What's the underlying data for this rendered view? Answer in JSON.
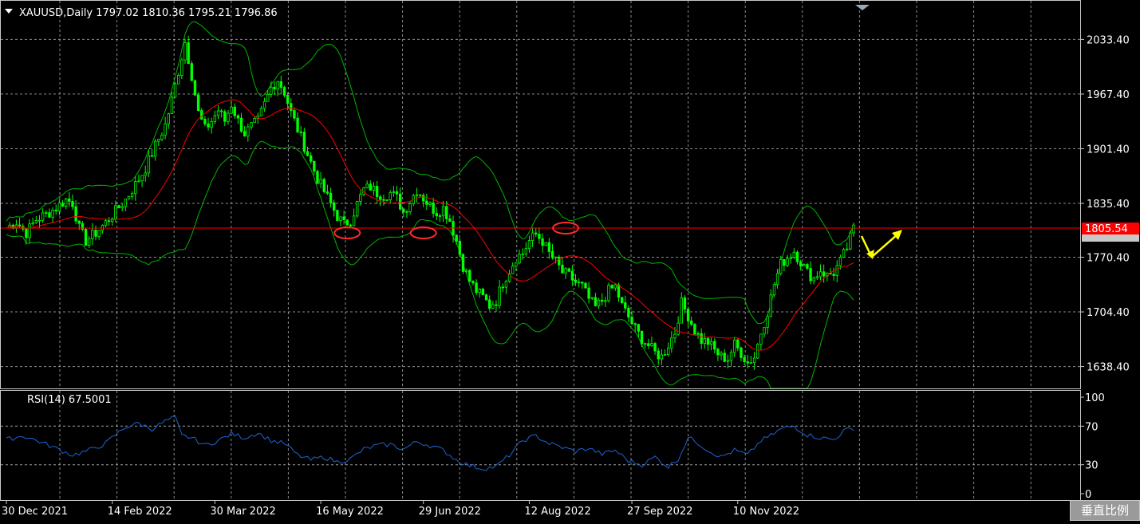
{
  "window": {
    "symbol_header": "XAUUSD,Daily  1797.02 1810.36 1795.21 1796.86",
    "scale_button": "垂直比例",
    "colors": {
      "background": "#000000",
      "grid": "#c8c8c8",
      "bull_candle": "#00ff00",
      "ma": "#ff0000",
      "bands": "#00b400",
      "rsi": "#1e64d2",
      "hline": "#ff0000",
      "markers": "#ff2b2b",
      "arrows": "#ffff00",
      "price_tag": "#ff0000"
    }
  },
  "chart_data": [
    {
      "type": "candlestick",
      "title": "XAUUSD,Daily  1797.02 1810.36 1795.21 1796.86",
      "ohlc_last": {
        "open": 1797.02,
        "high": 1810.36,
        "low": 1795.21,
        "close": 1796.86
      },
      "x": [
        "30 Dec 2021",
        "14 Feb 2022",
        "30 Mar 2022",
        "16 May 2022",
        "29 Jun 2022",
        "12 Aug 2022",
        "27 Sep 2022",
        "10 Nov 2022"
      ],
      "yticks": [
        "2033.40",
        "1967.40",
        "1901.40",
        "1835.40",
        "1770.40",
        "1704.40",
        "1638.40"
      ],
      "ylim": [
        1612,
        2080
      ],
      "price_line": {
        "value": 1805.54,
        "label": "1805.54"
      },
      "close_series": [
        [
          0,
          1806
        ],
        [
          3,
          1813
        ],
        [
          6,
          1800
        ],
        [
          9,
          1816
        ],
        [
          12,
          1822
        ],
        [
          15,
          1830
        ],
        [
          18,
          1840
        ],
        [
          20,
          1836
        ],
        [
          22,
          1805
        ],
        [
          24,
          1790
        ],
        [
          27,
          1800
        ],
        [
          30,
          1812
        ],
        [
          33,
          1826
        ],
        [
          36,
          1840
        ],
        [
          39,
          1858
        ],
        [
          42,
          1878
        ],
        [
          45,
          1905
        ],
        [
          48,
          1930
        ],
        [
          50,
          1960
        ],
        [
          52,
          1995
        ],
        [
          54,
          2030
        ],
        [
          56,
          1990
        ],
        [
          58,
          1945
        ],
        [
          60,
          1925
        ],
        [
          62,
          1935
        ],
        [
          64,
          1948
        ],
        [
          66,
          1935
        ],
        [
          68,
          1955
        ],
        [
          70,
          1935
        ],
        [
          72,
          1920
        ],
        [
          74,
          1928
        ],
        [
          76,
          1935
        ],
        [
          78,
          1955
        ],
        [
          80,
          1975
        ],
        [
          82,
          1985
        ],
        [
          84,
          1970
        ],
        [
          86,
          1945
        ],
        [
          88,
          1925
        ],
        [
          90,
          1905
        ],
        [
          92,
          1885
        ],
        [
          94,
          1865
        ],
        [
          96,
          1850
        ],
        [
          98,
          1835
        ],
        [
          100,
          1820
        ],
        [
          102,
          1810
        ],
        [
          104,
          1815
        ],
        [
          106,
          1835
        ],
        [
          108,
          1852
        ],
        [
          110,
          1855
        ],
        [
          112,
          1848
        ],
        [
          114,
          1845
        ],
        [
          116,
          1848
        ],
        [
          118,
          1842
        ],
        [
          120,
          1825
        ],
        [
          122,
          1838
        ],
        [
          124,
          1852
        ],
        [
          126,
          1842
        ],
        [
          128,
          1832
        ],
        [
          130,
          1825
        ],
        [
          132,
          1830
        ],
        [
          134,
          1815
        ],
        [
          136,
          1790
        ],
        [
          138,
          1760
        ],
        [
          140,
          1742
        ],
        [
          142,
          1730
        ],
        [
          144,
          1722
        ],
        [
          146,
          1712
        ],
        [
          148,
          1718
        ],
        [
          150,
          1740
        ],
        [
          152,
          1755
        ],
        [
          154,
          1770
        ],
        [
          156,
          1775
        ],
        [
          158,
          1790
        ],
        [
          160,
          1798
        ],
        [
          162,
          1790
        ],
        [
          164,
          1775
        ],
        [
          166,
          1765
        ],
        [
          168,
          1752
        ],
        [
          170,
          1748
        ],
        [
          172,
          1740
        ],
        [
          174,
          1735
        ],
        [
          176,
          1720
        ],
        [
          178,
          1710
        ],
        [
          180,
          1718
        ],
        [
          182,
          1730
        ],
        [
          184,
          1735
        ],
        [
          186,
          1712
        ],
        [
          188,
          1698
        ],
        [
          190,
          1684
        ],
        [
          192,
          1672
        ],
        [
          194,
          1664
        ],
        [
          196,
          1655
        ],
        [
          198,
          1650
        ],
        [
          200,
          1665
        ],
        [
          202,
          1680
        ],
        [
          204,
          1715
        ],
        [
          206,
          1700
        ],
        [
          208,
          1682
        ],
        [
          210,
          1670
        ],
        [
          212,
          1668
        ],
        [
          214,
          1658
        ],
        [
          216,
          1650
        ],
        [
          218,
          1648
        ],
        [
          220,
          1665
        ],
        [
          222,
          1655
        ],
        [
          224,
          1643
        ],
        [
          226,
          1650
        ],
        [
          228,
          1680
        ],
        [
          230,
          1705
        ],
        [
          232,
          1738
        ],
        [
          234,
          1762
        ],
        [
          236,
          1770
        ],
        [
          238,
          1778
        ],
        [
          240,
          1765
        ],
        [
          242,
          1752
        ],
        [
          244,
          1745
        ],
        [
          246,
          1755
        ],
        [
          248,
          1748
        ],
        [
          250,
          1752
        ],
        [
          252,
          1765
        ],
        [
          254,
          1782
        ],
        [
          256,
          1805
        ]
      ],
      "indicators": [
        "MA (red)",
        "Bollinger Bands (green)"
      ],
      "annotations": [
        "red ellipses at support touches",
        "yellow arrows projecting pullback then rise"
      ]
    },
    {
      "type": "line",
      "title": "RSI(14) 67.5001",
      "yticks": [
        "100",
        "70",
        "30",
        "0"
      ],
      "ylim": [
        0,
        100
      ],
      "levels": [
        70,
        30
      ],
      "series": [
        {
          "name": "RSI(14)",
          "values": [
            [
              0,
              56
            ],
            [
              5,
              60
            ],
            [
              10,
              54
            ],
            [
              15,
              47
            ],
            [
              20,
              40
            ],
            [
              25,
              45
            ],
            [
              30,
              52
            ],
            [
              33,
              61
            ],
            [
              36,
              69
            ],
            [
              40,
              73
            ],
            [
              44,
              67
            ],
            [
              48,
              75
            ],
            [
              51,
              79
            ],
            [
              53,
              60
            ],
            [
              56,
              58
            ],
            [
              60,
              50
            ],
            [
              64,
              55
            ],
            [
              68,
              62
            ],
            [
              72,
              58
            ],
            [
              76,
              63
            ],
            [
              80,
              55
            ],
            [
              84,
              52
            ],
            [
              88,
              40
            ],
            [
              92,
              35
            ],
            [
              96,
              38
            ],
            [
              100,
              33
            ],
            [
              104,
              36
            ],
            [
              108,
              46
            ],
            [
              112,
              50
            ],
            [
              116,
              51
            ],
            [
              120,
              46
            ],
            [
              124,
              54
            ],
            [
              128,
              50
            ],
            [
              132,
              45
            ],
            [
              136,
              35
            ],
            [
              140,
              29
            ],
            [
              144,
              26
            ],
            [
              148,
              28
            ],
            [
              152,
              40
            ],
            [
              156,
              55
            ],
            [
              160,
              60
            ],
            [
              164,
              52
            ],
            [
              168,
              48
            ],
            [
              172,
              44
            ],
            [
              176,
              47
            ],
            [
              180,
              41
            ],
            [
              184,
              45
            ],
            [
              188,
              34
            ],
            [
              192,
              30
            ],
            [
              196,
              38
            ],
            [
              200,
              28
            ],
            [
              203,
              36
            ],
            [
              206,
              58
            ],
            [
              208,
              55
            ],
            [
              212,
              45
            ],
            [
              216,
              38
            ],
            [
              220,
              45
            ],
            [
              224,
              40
            ],
            [
              228,
              55
            ],
            [
              231,
              60
            ],
            [
              234,
              67
            ],
            [
              238,
              70
            ],
            [
              242,
              61
            ],
            [
              246,
              58
            ],
            [
              250,
              56
            ],
            [
              253,
              65
            ],
            [
              256,
              68
            ]
          ]
        }
      ],
      "value_label": "67.5001"
    }
  ]
}
